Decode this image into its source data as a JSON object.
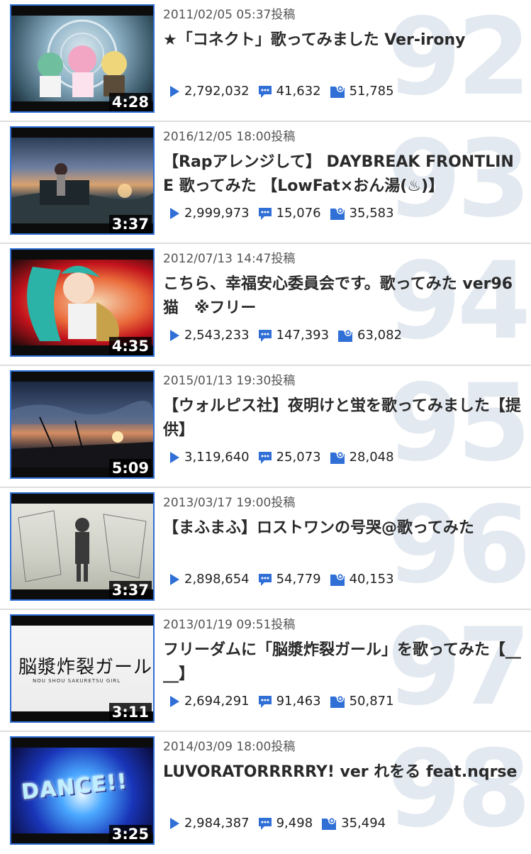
{
  "colors": {
    "accent": "#2f6fd6",
    "rank_number": "#e3e9f0",
    "divider": "#dedede"
  },
  "icons": {
    "views": "play-icon",
    "comments": "comment-icon",
    "mylists": "mylist-icon"
  },
  "videos": [
    {
      "rank": "92",
      "posted": "2011/02/05 05:37投稿",
      "title": "★「コネクト」歌ってみました Ver-irony",
      "duration": "4:28",
      "views": "2,792,032",
      "comments": "41,632",
      "mylists": "51,785"
    },
    {
      "rank": "93",
      "posted": "2016/12/05 18:00投稿",
      "title": "【Rapアレンジして】 DAYBREAK FRONTLINE 歌ってみた 【LowFat×おん湯(♨)】",
      "duration": "3:37",
      "views": "2,999,973",
      "comments": "15,076",
      "mylists": "35,583"
    },
    {
      "rank": "94",
      "posted": "2012/07/13 14:47投稿",
      "title": "こちら、幸福安心委員会です。歌ってみた ver96猫　※フリー",
      "duration": "4:35",
      "views": "2,543,233",
      "comments": "147,393",
      "mylists": "63,082"
    },
    {
      "rank": "95",
      "posted": "2015/01/13 19:30投稿",
      "title": "【ウォルピス社】夜明けと蛍を歌ってみました【提供】",
      "duration": "5:09",
      "views": "3,119,640",
      "comments": "25,073",
      "mylists": "28,048"
    },
    {
      "rank": "96",
      "posted": "2013/03/17 19:00投稿",
      "title": "【まふまふ】ロストワンの号哭@歌ってみた",
      "duration": "3:37",
      "views": "2,898,654",
      "comments": "54,779",
      "mylists": "40,153"
    },
    {
      "rank": "97",
      "posted": "2013/01/19 09:51投稿",
      "title": "フリーダムに「脳漿炸裂ガール」を歌ってみた【____】",
      "duration": "3:11",
      "views": "2,694,291",
      "comments": "91,463",
      "mylists": "50,871",
      "thumb_text": "脳漿炸裂ガール",
      "thumb_subtext": "NOU SHOU SAKURETSU GIRL"
    },
    {
      "rank": "98",
      "posted": "2014/03/09 18:00投稿",
      "title": "LUVORATORRRRRY! ver れをる feat.nqrse",
      "duration": "3:25",
      "views": "2,984,387",
      "comments": "9,498",
      "mylists": "35,494",
      "thumb_text": "DANCE!!"
    }
  ]
}
